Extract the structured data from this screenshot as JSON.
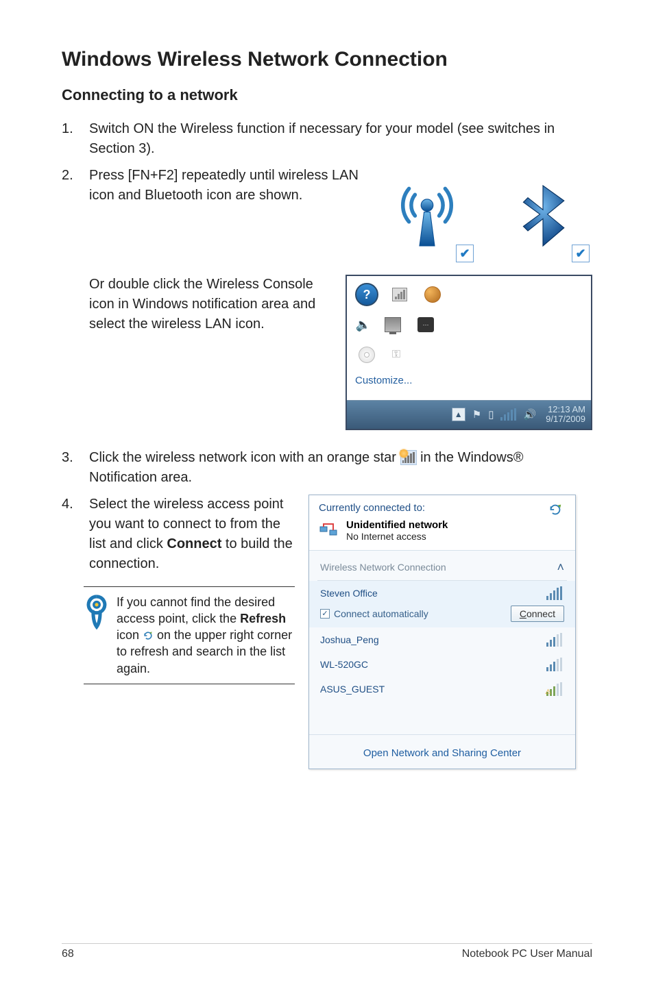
{
  "page": {
    "title": "Windows Wireless Network Connection",
    "subtitle": "Connecting to a network",
    "page_number": "68",
    "manual_label": "Notebook PC User Manual"
  },
  "steps": {
    "s1_num": "1.",
    "s1": "Switch ON the Wireless function if necessary for your model (see switches in Section 3).",
    "s2_num": "2.",
    "s2": "Press [FN+F2] repeatedly until wireless LAN icon and Bluetooth icon are shown.",
    "s2_or": "Or double click the Wireless Console icon in Windows notification area and select the wireless LAN icon.",
    "s3_num": "3.",
    "s3a": "Click the wireless network icon with an orange star ",
    "s3b": " in the Windows® Notification area.",
    "s4_num": "4.",
    "s4a": "Select the wireless access point you want to connect to from the list and click ",
    "s4_connect_word": "Connect",
    "s4b": " to build the connection."
  },
  "callout": {
    "before_refresh": "If you cannot find the desired access point, click the ",
    "refresh_word": "Refresh",
    "mid": " icon ",
    "after": " on the upper right corner to refresh and search in the list again."
  },
  "tray": {
    "customize": "Customize...",
    "time": "12:13 AM",
    "date": "9/17/2009"
  },
  "wifi_popup": {
    "connected_to": "Currently connected to:",
    "net_title": "Unidentified network",
    "net_sub": "No Internet access",
    "section_header": "Wireless Network Connection",
    "auto_label": "Connect automatically",
    "connect_button": "Connect",
    "footer_link": "Open Network and Sharing Center",
    "items": {
      "i0": "Steven Office",
      "i1": "Joshua_Peng",
      "i2": "WL-520GC",
      "i3": "ASUS_GUEST"
    }
  }
}
